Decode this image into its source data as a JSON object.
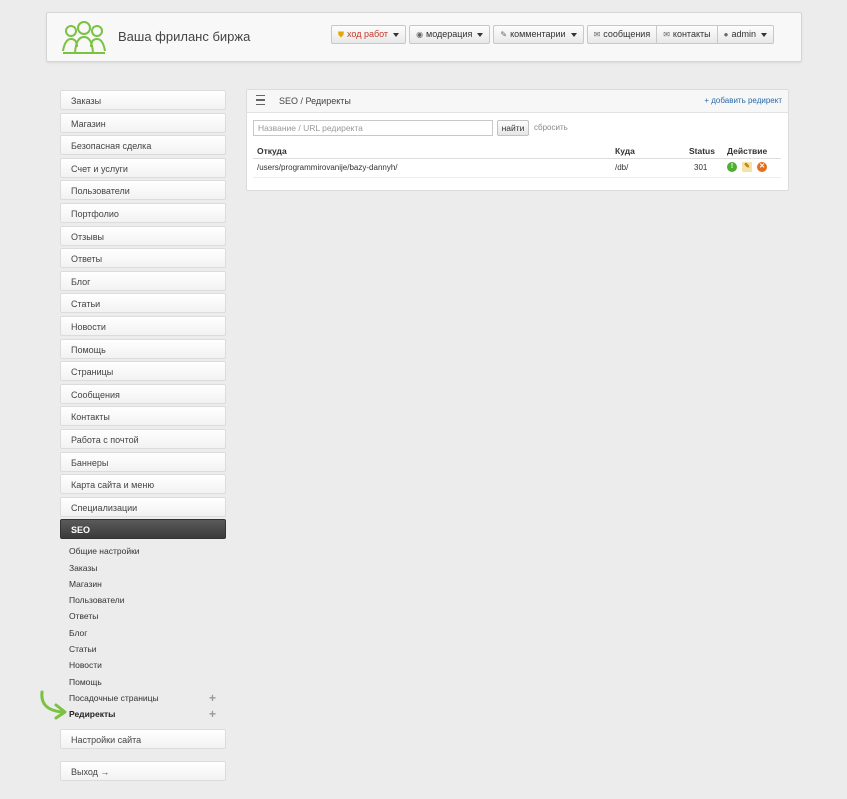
{
  "header": {
    "site_title": "Ваша фриланс биржа",
    "nav": [
      {
        "label": "ход работ",
        "icon": "shield-icon",
        "dropdown": true
      },
      {
        "label": "модерация",
        "icon": "eye-icon",
        "dropdown": true
      },
      {
        "label": "комментарии",
        "icon": "pencil-icon",
        "dropdown": true
      }
    ],
    "nav_group": [
      {
        "label": "сообщения",
        "icon": "envelope-icon"
      },
      {
        "label": "контакты",
        "icon": "envelope-icon"
      },
      {
        "label": "admin",
        "icon": "user-icon",
        "dropdown": true
      }
    ]
  },
  "sidebar": {
    "items": [
      "Заказы",
      "Магазин",
      "Безопасная сделка",
      "Счет и услуги",
      "Пользователи",
      "Портфолио",
      "Отзывы",
      "Ответы",
      "Блог",
      "Статьи",
      "Новости",
      "Помощь",
      "Страницы",
      "Сообщения",
      "Контакты",
      "Работа с почтой",
      "Баннеры",
      "Карта сайта и меню",
      "Специализации"
    ],
    "active": "SEO",
    "sub_items": [
      "Общие настройки",
      "Заказы",
      "Магазин",
      "Пользователи",
      "Ответы",
      "Блог",
      "Статьи",
      "Новости",
      "Помощь",
      "Посадочные страницы",
      "Редиректы"
    ],
    "settings": "Настройки сайта",
    "logout": "Выход →"
  },
  "panel": {
    "title": "SEO / Редиректы",
    "add_link": "+ добавить редирект",
    "search_placeholder": "Название / URL редиректа",
    "search_button": "найти",
    "reset": "сбросить",
    "columns": [
      "Откуда",
      "Куда",
      "Status",
      "Действие"
    ],
    "rows": [
      {
        "from": "/users/programmirovanije/bazy-dannyh/",
        "to": "/db/",
        "status": "301"
      }
    ]
  },
  "colors": {
    "accent": "#2a6aa8",
    "active_bg": "#3a3a3a",
    "arrow": "#7cc242"
  }
}
